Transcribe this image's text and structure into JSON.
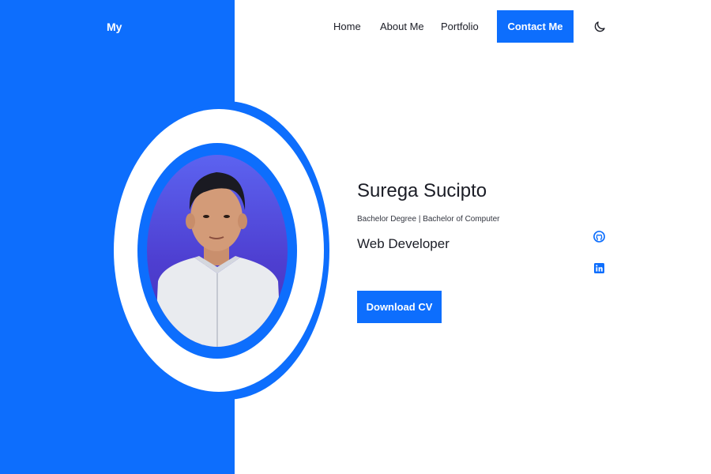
{
  "brand": {
    "logo_text": "My"
  },
  "nav": {
    "items": [
      {
        "label": "Home"
      },
      {
        "label": "About Me"
      },
      {
        "label": "Portfolio"
      }
    ],
    "contact_label": "Contact Me",
    "theme_icon": "moon-icon"
  },
  "hero": {
    "name": "Surega Sucipto",
    "degree": "Bachelor Degree | Bachelor of Computer",
    "role": "Web Developer",
    "cv_button": "Download CV"
  },
  "social": [
    {
      "icon": "github-icon"
    },
    {
      "icon": "linkedin-icon"
    }
  ],
  "colors": {
    "accent": "#0d6efd",
    "text": "#1b1d26",
    "photo_bg": "#4e3fd1"
  }
}
